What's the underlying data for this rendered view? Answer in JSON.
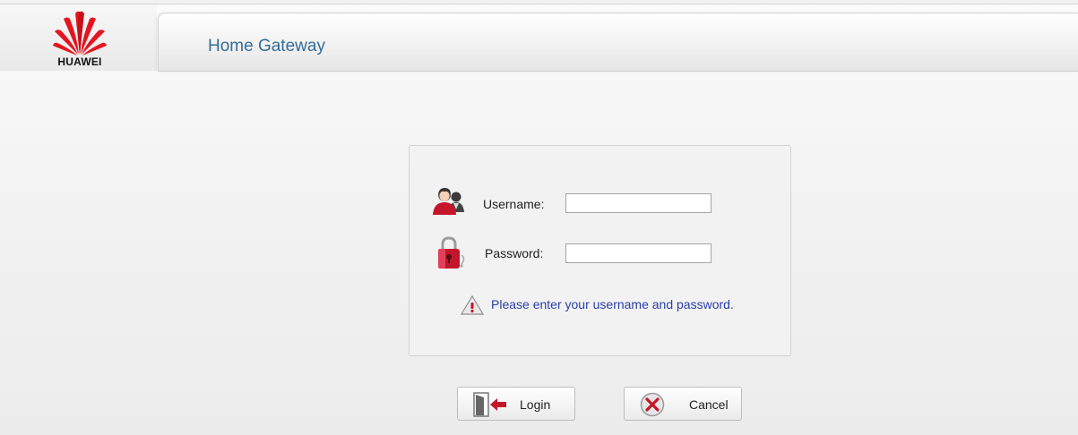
{
  "brand": {
    "name": "HUAWEI",
    "logo_color": "#e4151f"
  },
  "header": {
    "title": "Home Gateway"
  },
  "login_form": {
    "username_label": "Username:",
    "username_value": "",
    "password_label": "Password:",
    "password_value": "",
    "message": "Please enter your username and password."
  },
  "buttons": {
    "login_label": "Login",
    "cancel_label": "Cancel"
  },
  "icons": {
    "user": "user-icon",
    "password": "lock-icon",
    "warning": "warning-triangle-icon",
    "login": "door-arrow-icon",
    "cancel": "cancel-x-icon"
  },
  "colors": {
    "title_text": "#336c98",
    "message_text": "#2a3fa8"
  }
}
